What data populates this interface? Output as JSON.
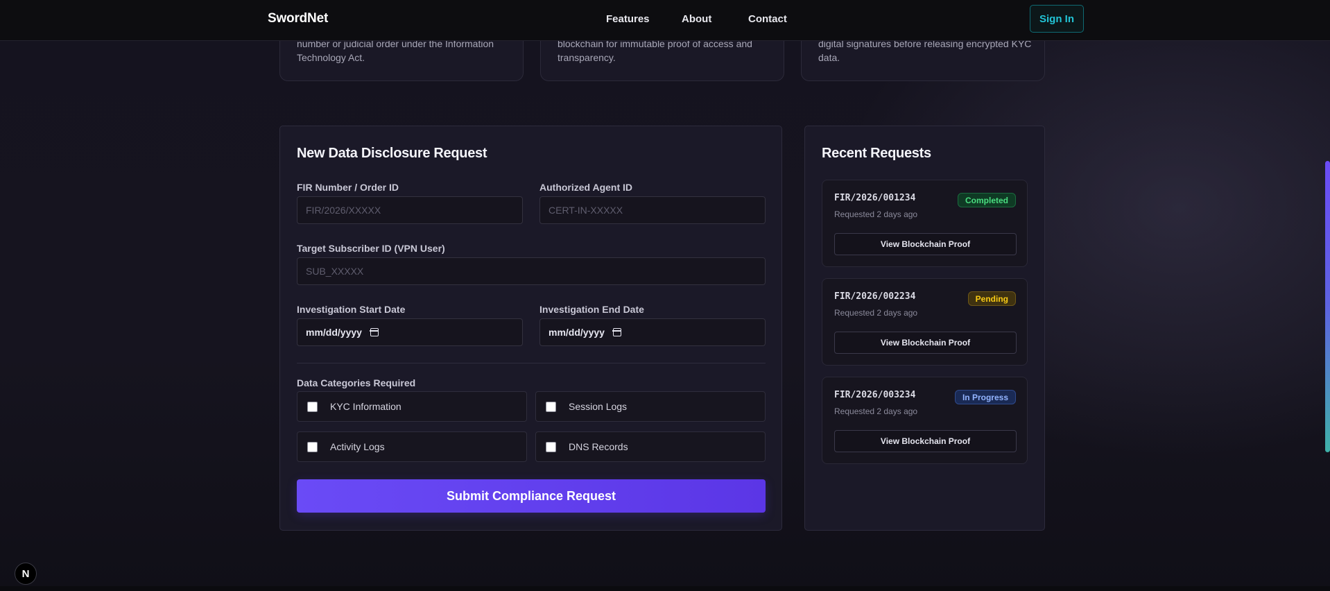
{
  "nav": {
    "brand": "SwordNet",
    "links": [
      "Features",
      "About",
      "Contact"
    ],
    "sign_in": "Sign In"
  },
  "feature_cards": [
    {
      "text": "number or judicial order under the Information Technology Act."
    },
    {
      "text": "blockchain for immutable proof of access and transparency."
    },
    {
      "text": "digital signatures before releasing encrypted KYC data."
    }
  ],
  "form": {
    "title": "New Data Disclosure Request",
    "fir_label": "FIR Number / Order ID",
    "fir_placeholder": "FIR/2026/XXXXX",
    "agent_label": "Authorized Agent ID",
    "agent_placeholder": "CERT-IN-XXXXX",
    "subscriber_label": "Target Subscriber ID (VPN User)",
    "subscriber_placeholder": "SUB_XXXXX",
    "start_label": "Investigation Start Date",
    "start_value": "mm/dd/yyyy",
    "end_label": "Investigation End Date",
    "end_value": "mm/dd/yyyy",
    "categories_label": "Data Categories Required",
    "categories": [
      "KYC Information",
      "Session Logs",
      "Activity Logs",
      "DNS Records"
    ],
    "submit": "Submit Compliance Request"
  },
  "recent": {
    "title": "Recent Requests",
    "items": [
      {
        "id": "FIR/2026/001234",
        "time": "Requested 2 days ago",
        "status": "Completed",
        "action": "View Blockchain Proof"
      },
      {
        "id": "FIR/2026/002234",
        "time": "Requested 2 days ago",
        "status": "Pending",
        "action": "View Blockchain Proof"
      },
      {
        "id": "FIR/2026/003234",
        "time": "Requested 2 days ago",
        "status": "In Progress",
        "action": "View Blockchain Proof"
      }
    ]
  },
  "floating_badge": "N",
  "colors": {
    "accent": "#6a4bf6",
    "sign_in": "#22c4d6",
    "completed": "#4ade80",
    "pending": "#facc15",
    "in_progress": "#93b4ff"
  }
}
